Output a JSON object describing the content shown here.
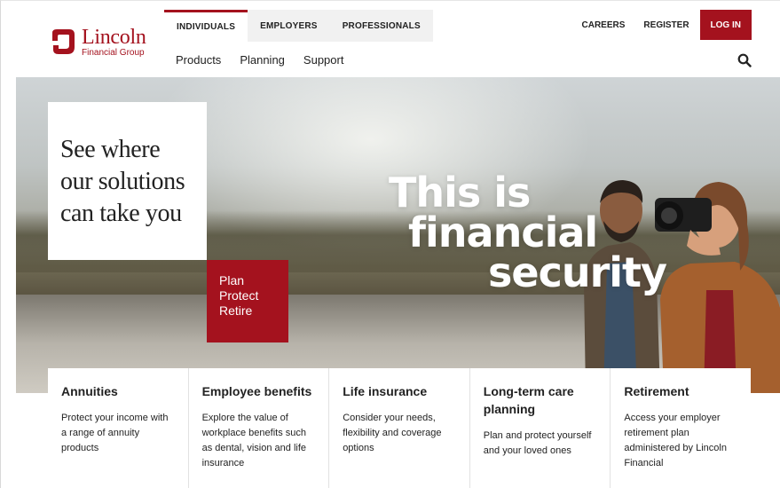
{
  "brand": {
    "name": "Lincoln",
    "sub": "Financial Group",
    "accent": "#a4121e"
  },
  "audience_tabs": [
    "INDIVIDUALS",
    "EMPLOYERS",
    "PROFESSIONALS"
  ],
  "active_audience": "INDIVIDUALS",
  "utility": {
    "careers": "CAREERS",
    "register": "REGISTER",
    "login": "LOG IN"
  },
  "main_nav": [
    "Products",
    "Planning",
    "Support"
  ],
  "icons": {
    "search": "search-icon"
  },
  "hero": {
    "headline_1": "This is",
    "headline_2": "financial",
    "headline_3": "security",
    "promo": "See where our solutions can take you",
    "cta_1": "Plan",
    "cta_2": "Protect",
    "cta_3": "Retire"
  },
  "cards": [
    {
      "title": "Annuities",
      "desc": "Protect your income with a range of annuity products"
    },
    {
      "title": "Employee benefits",
      "desc": "Explore the value of workplace benefits such as dental, vision and life insurance"
    },
    {
      "title": "Life insurance",
      "desc": "Consider your needs, flexibility and coverage options"
    },
    {
      "title": "Long-term care planning",
      "desc": "Plan and protect yourself and your loved ones"
    },
    {
      "title": "Retirement",
      "desc": "Access your employer retirement plan administered by Lincoln Financial"
    }
  ]
}
